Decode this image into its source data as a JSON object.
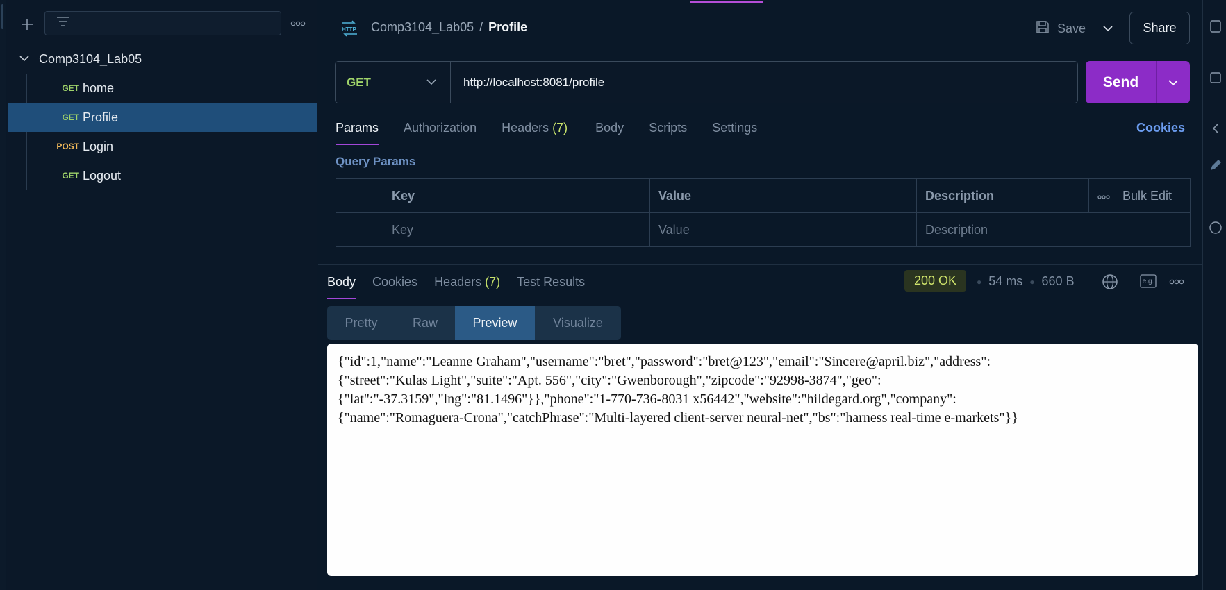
{
  "sidebar": {
    "filter_placeholder": "",
    "collection": {
      "name": "Comp3104_Lab05"
    },
    "requests": [
      {
        "method": "GET",
        "name": "home"
      },
      {
        "method": "GET",
        "name": "Profile"
      },
      {
        "method": "POST",
        "name": "Login"
      },
      {
        "method": "GET",
        "name": "Logout"
      }
    ]
  },
  "header": {
    "icon": "http-icon",
    "breadcrumb_collection": "Comp3104_Lab05",
    "breadcrumb_sep": "/",
    "breadcrumb_current": "Profile",
    "save_label": "Save",
    "share_label": "Share"
  },
  "request": {
    "method": "GET",
    "url": "http://localhost:8081/profile",
    "send_label": "Send",
    "tabs": {
      "params": "Params",
      "authorization": "Authorization",
      "headers": "Headers",
      "headers_count": "(7)",
      "body": "Body",
      "scripts": "Scripts",
      "settings": "Settings"
    },
    "cookies_label": "Cookies",
    "query_params_label": "Query Params",
    "params_table": {
      "headers": {
        "key": "Key",
        "value": "Value",
        "description": "Description",
        "bulk_edit": "Bulk Edit"
      },
      "placeholders": {
        "key": "Key",
        "value": "Value",
        "description": "Description"
      }
    }
  },
  "response": {
    "tabs": {
      "body": "Body",
      "cookies": "Cookies",
      "headers": "Headers",
      "headers_count": "(7)",
      "test_results": "Test Results"
    },
    "status": "200 OK",
    "time": "54 ms",
    "size": "660 B",
    "eg_label": "e.g.",
    "view_modes": [
      "Pretty",
      "Raw",
      "Preview",
      "Visualize"
    ],
    "active_view": "Preview",
    "preview_text": "{\"id\":1,\"name\":\"Leanne Graham\",\"username\":\"bret\",\"password\":\"bret@123\",\"email\":\"Sincere@april.biz\",\"address\":\n{\"street\":\"Kulas Light\",\"suite\":\"Apt. 556\",\"city\":\"Gwenborough\",\"zipcode\":\"92998-3874\",\"geo\":\n{\"lat\":\"-37.3159\",\"lng\":\"81.1496\"}},\"phone\":\"1-770-736-8031 x56442\",\"website\":\"hildegard.org\",\"company\":\n{\"name\":\"Romaguera-Crona\",\"catchPhrase\":\"Multi-layered client-server neural-net\",\"bs\":\"harness real-time e-markets\"}}"
  },
  "colors": {
    "accent": "#8c2cc7",
    "get": "#9fd36a",
    "post": "#f0b85a",
    "active_row": "#1f4e7a",
    "status_ok": "#cfe36b"
  }
}
